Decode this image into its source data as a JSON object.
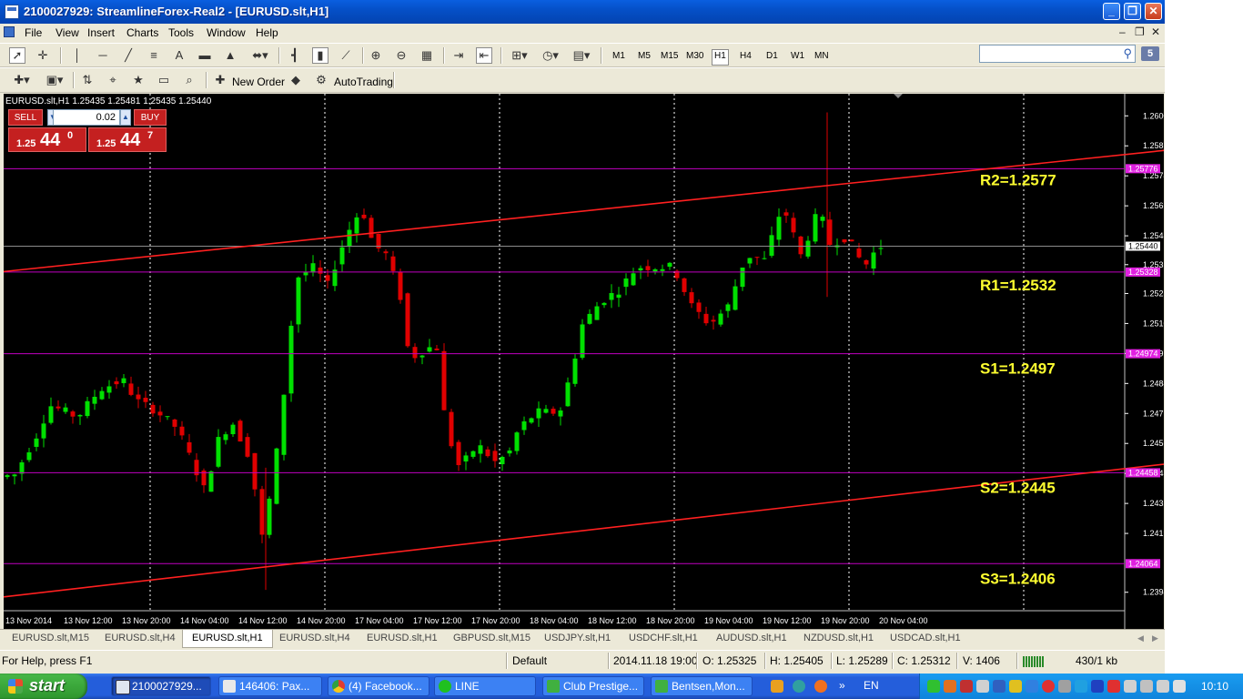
{
  "window": {
    "title": "2100027929: StreamlineForex-Real2 - [EURUSD.slt,H1]",
    "minimize": "_",
    "maximize": "❐",
    "close": "✕"
  },
  "menu": {
    "items": [
      "File",
      "View",
      "Insert",
      "Charts",
      "Tools",
      "Window",
      "Help"
    ],
    "mdi_controls": [
      "–",
      "❐",
      "✕"
    ]
  },
  "toolbar": {
    "timeframes": [
      "M1",
      "M5",
      "M15",
      "M30",
      "H1",
      "H4",
      "D1",
      "W1",
      "MN"
    ],
    "active_timeframe": "H1",
    "new_order_label": "New Order",
    "autotrading_label": "AutoTrading",
    "search_placeholder": "",
    "notification_count": "5"
  },
  "chart": {
    "info": "EURUSD.slt,H1  1.25435 1.25481 1.25435 1.25440",
    "one_click": {
      "sell_label": "SELL",
      "buy_label": "BUY",
      "lot": "0.02",
      "sell_small": "1.25",
      "sell_big": "44",
      "sell_sup": "0",
      "buy_small": "1.25",
      "buy_big": "44",
      "buy_sup": "7"
    },
    "price_scale": [
      "1.26005",
      "1.25875",
      "1.25745",
      "1.25615",
      "1.25485",
      "1.25360",
      "1.25235",
      "1.25105",
      "1.24975",
      "1.24845",
      "1.24715",
      "1.24585",
      "1.24455",
      "1.24325",
      "1.24195",
      "1.23940"
    ],
    "price_scale_tags": [
      "1.25776",
      "1.25440",
      "1.25328",
      "1.24974",
      "1.24458",
      "1.24064"
    ],
    "time_labels": [
      "13 Nov 2014",
      "13 Nov 12:00",
      "13 Nov 20:00",
      "14 Nov 04:00",
      "14 Nov 12:00",
      "14 Nov 20:00",
      "17 Nov 04:00",
      "17 Nov 12:00",
      "17 Nov 20:00",
      "18 Nov 04:00",
      "18 Nov 12:00",
      "18 Nov 20:00",
      "19 Nov 04:00",
      "19 Nov 12:00",
      "19 Nov 20:00",
      "20 Nov 04:00"
    ],
    "levels": [
      {
        "label": "R2=1.2577",
        "price": 1.25776
      },
      {
        "label": "R1=1.2532",
        "price": 1.25328
      },
      {
        "label": "S1=1.2497",
        "price": 1.24974
      },
      {
        "label": "S2=1.2445",
        "price": 1.24458
      },
      {
        "label": "S3=1.2406",
        "price": 1.24064
      }
    ],
    "current_price": 1.2544,
    "colors": {
      "background": "#000000",
      "bull": "#00e000",
      "bear": "#e00000",
      "level_line": "#c000c0",
      "trend_line": "#ff2020",
      "level_text": "#ffff30",
      "tag_bg": "#e020e0"
    }
  },
  "tabs": [
    "EURUSD.slt,M15",
    "EURUSD.slt,H4",
    "EURUSD.slt,H1",
    "EURUSD.slt,H4",
    "EURUSD.slt,H1",
    "GBPUSD.slt,M15",
    "USDJPY.slt,H1",
    "USDCHF.slt,H1",
    "AUDUSD.slt,H1",
    "NZDUSD.slt,H1",
    "USDCAD.slt,H1"
  ],
  "active_tab_index": 2,
  "status": {
    "help": "For Help, press F1",
    "profile": "Default",
    "datetime": "2014.11.18 19:00",
    "open": "O: 1.25325",
    "high": "H: 1.25405",
    "low": "L: 1.25289",
    "close": "C: 1.25312",
    "volume": "V: 1406",
    "traffic": "430/1 kb"
  },
  "taskbar": {
    "start_label": "start",
    "tasks": [
      "2100027929...",
      "146406: Pax...",
      "(4) Facebook...",
      "LINE",
      "Club Prestige...",
      "Bentsen,Mon..."
    ],
    "language": "EN",
    "clock": "10:10"
  }
}
